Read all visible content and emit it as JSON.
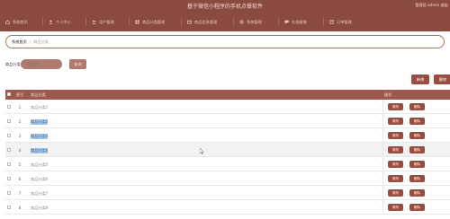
{
  "header": {
    "title": "基于微信小程序的手机点餐软件",
    "user": "管理员 admin  退出"
  },
  "nav": [
    {
      "label": "系统首页",
      "icon": "home-icon"
    },
    {
      "label": "个人中心",
      "icon": "user-icon"
    },
    {
      "label": "用户管理",
      "icon": "users-icon"
    },
    {
      "label": "商品分类管理",
      "icon": "category-icon"
    },
    {
      "label": "商品信息管理",
      "icon": "goods-icon"
    },
    {
      "label": "系统管理",
      "icon": "settings-icon"
    },
    {
      "label": "在线客服",
      "icon": "chat-icon"
    },
    {
      "label": "订单管理",
      "icon": "order-icon"
    }
  ],
  "breadcrumb": {
    "home": "系统首页",
    "current": "商品分类"
  },
  "search": {
    "label": "商品分类",
    "placeholder": "商品分类",
    "button": "查询"
  },
  "actions": {
    "add": "新增",
    "delete": "删除"
  },
  "table": {
    "headers": {
      "index": "索引",
      "name": "商品分类",
      "ops": "操作"
    },
    "edit_label": "修改",
    "delete_label": "删除",
    "rows": [
      {
        "index": "1",
        "name": "商品分类1",
        "selected": false
      },
      {
        "index": "2",
        "name": "商品分类2",
        "selected": true
      },
      {
        "index": "3",
        "name": "商品分类3",
        "selected": true
      },
      {
        "index": "4",
        "name": "商品分类4",
        "selected": true
      },
      {
        "index": "5",
        "name": "商品分类5",
        "selected": false
      },
      {
        "index": "6",
        "name": "商品分类6",
        "selected": false
      },
      {
        "index": "7",
        "name": "商品分类7",
        "selected": false
      },
      {
        "index": "8",
        "name": "商品分类8",
        "selected": false
      }
    ]
  },
  "colors": {
    "primary": "#8a4a3f",
    "button": "#9a4c40",
    "header_row": "#9c5a4c",
    "input": "#b07a6e"
  }
}
